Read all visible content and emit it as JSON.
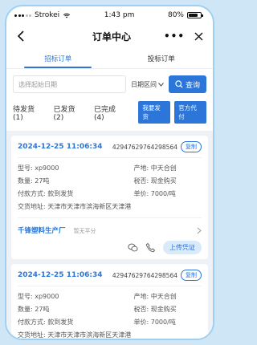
{
  "status_bar": {
    "carrier": "Strokei",
    "time": "1:43 pm",
    "battery": "80%"
  },
  "nav": {
    "title": "订单中心"
  },
  "tabs": [
    {
      "label": "招标订单",
      "active": true
    },
    {
      "label": "投标订单",
      "active": false
    }
  ],
  "search": {
    "placeholder": "选择起始日期",
    "date_range_label": "日期区间",
    "query_label": "查询"
  },
  "filters": {
    "items": [
      "待发货(1)",
      "已发货(2)",
      "已完成(4)"
    ],
    "my_shipment": "我要发货",
    "official_pay": "官方代付"
  },
  "orders": [
    {
      "time": "2024-12-25 11:06:34",
      "order_no": "42947629764298564",
      "copy_label": "复制",
      "model": "型号: xp9000",
      "origin": "产地: 中天合创",
      "quantity": "数量: 27吨",
      "tax": "税否: 现金购买",
      "payment": "付款方式: 款到发货",
      "unit_price": "单价: 7000/吨",
      "address": "交货地址: 天津市天津市滨海新区天津港",
      "company": "千锋塑料生产厂",
      "score": "暂无平分",
      "upload_label": "上传凭证"
    },
    {
      "time": "2024-12-25 11:06:34",
      "order_no": "42947629764298564",
      "copy_label": "复制",
      "model": "型号: xp9000",
      "origin": "产地: 中天合创",
      "quantity": "数量: 27吨",
      "tax": "税否: 现金购买",
      "payment": "付款方式: 款到发货",
      "unit_price": "单价: 7000/吨",
      "address": "交货地址: 天津市天津市滨海新区天津港"
    }
  ],
  "colors": {
    "accent": "#2b76d8",
    "list_bg": "#eef2f7",
    "frame": "#9fd0f1"
  }
}
